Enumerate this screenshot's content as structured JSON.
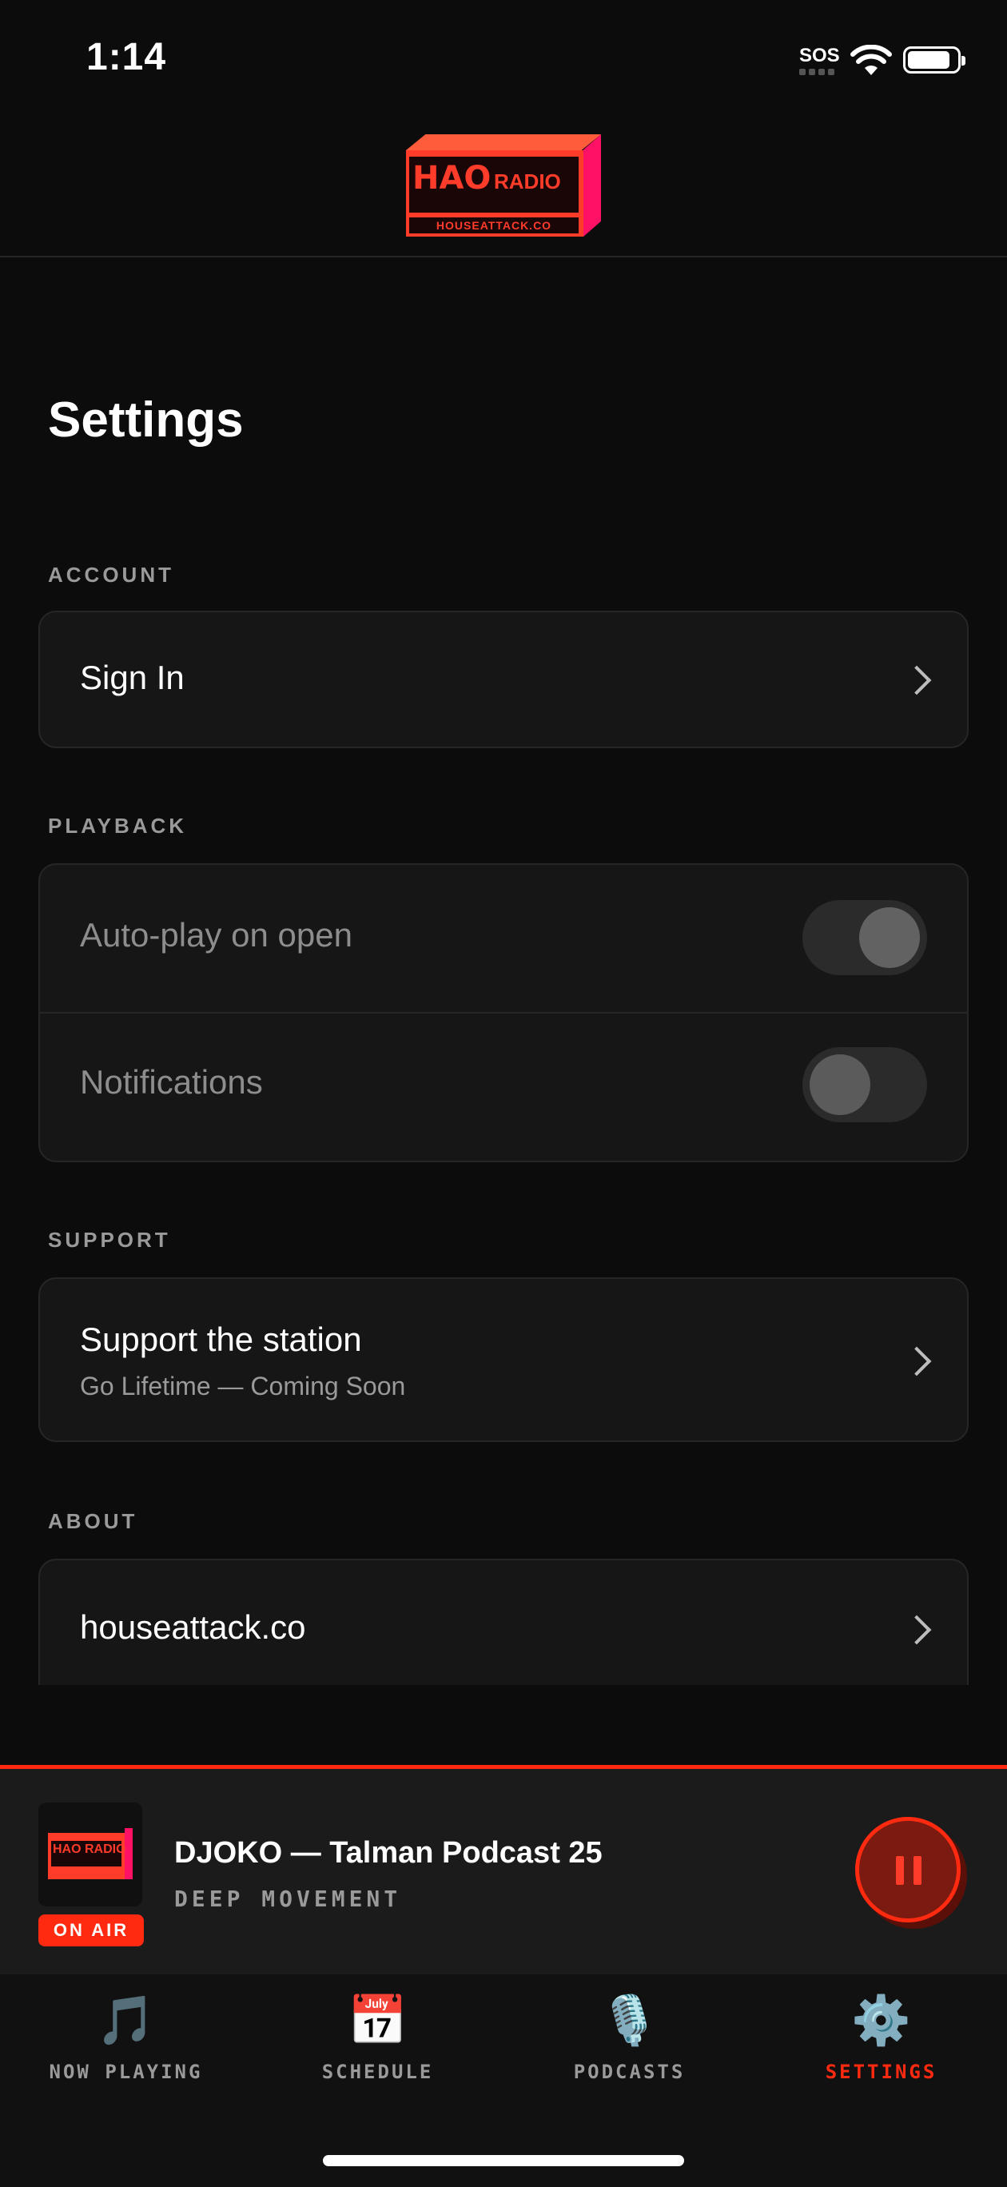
{
  "status_bar": {
    "time": "1:14",
    "sos": "SOS"
  },
  "header": {
    "logo_main": "HAO",
    "logo_radio": "RADIO",
    "logo_sub": "HOUSEATTACK.CO"
  },
  "page": {
    "title": "Settings"
  },
  "sections": {
    "account": {
      "label": "ACCOUNT",
      "sign_in": "Sign In"
    },
    "playback": {
      "label": "PLAYBACK",
      "autoplay": "Auto-play on open",
      "autoplay_on": true,
      "notifications": "Notifications",
      "notifications_on": false
    },
    "support": {
      "label": "SUPPORT",
      "title": "Support the station",
      "subtitle": "Go Lifetime — Coming Soon"
    },
    "about": {
      "label": "ABOUT",
      "website": "houseattack.co"
    }
  },
  "player": {
    "badge": "ON AIR",
    "title": "DJOKO — Talman Podcast 25",
    "artist": "DEEP MOVEMENT",
    "art_text": "HAO RADIO"
  },
  "tabs": [
    {
      "label": "NOW PLAYING",
      "icon": "music-notes-icon",
      "glyph": "🎵"
    },
    {
      "label": "SCHEDULE",
      "icon": "calendar-icon",
      "glyph": "📅"
    },
    {
      "label": "PODCASTS",
      "icon": "microphone-icon",
      "glyph": "🎙️"
    },
    {
      "label": "SETTINGS",
      "icon": "gear-icon",
      "glyph": "⚙️"
    }
  ],
  "colors": {
    "accent": "#ff2a10",
    "background": "#0c0c0c",
    "card": "#161616"
  }
}
